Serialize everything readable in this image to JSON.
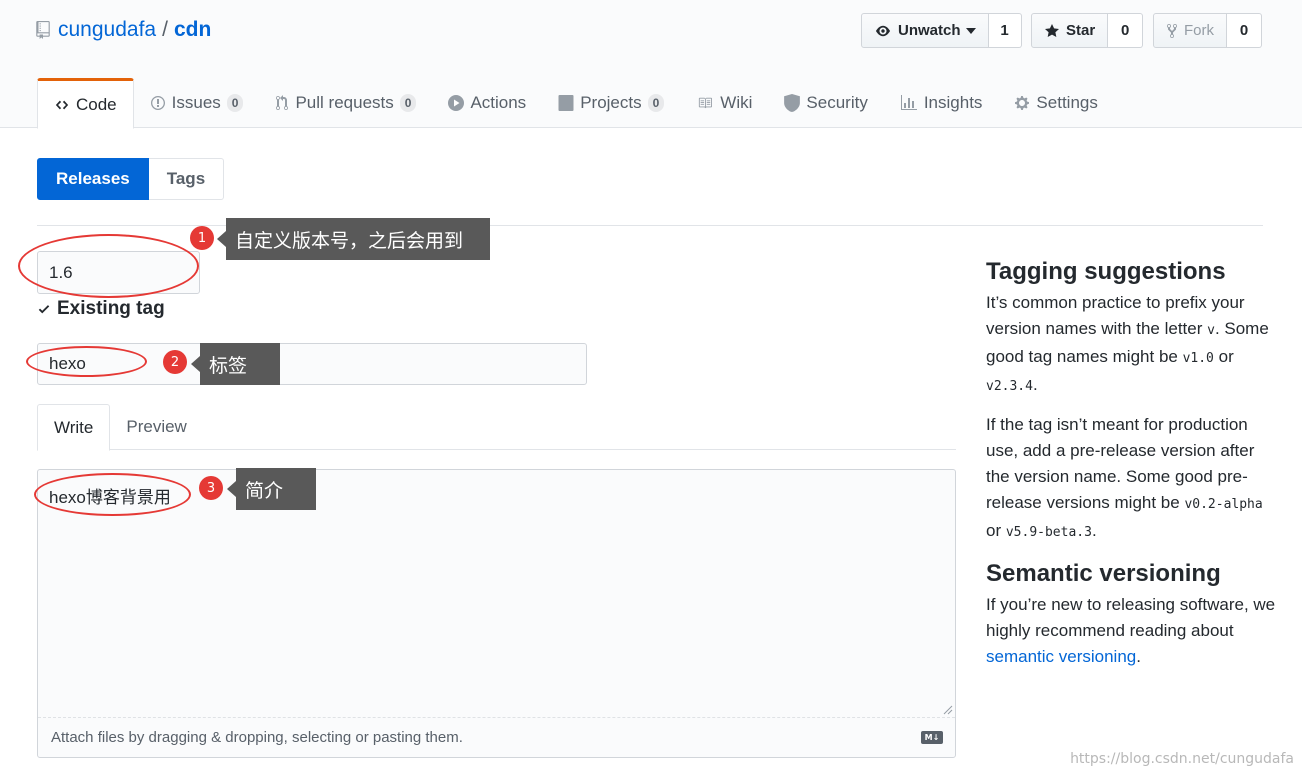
{
  "repo": {
    "owner": "cungudafa",
    "separator": "/",
    "name": "cdn"
  },
  "actions": {
    "watch": {
      "label": "Unwatch",
      "count": "1"
    },
    "star": {
      "label": "Star",
      "count": "0"
    },
    "fork": {
      "label": "Fork",
      "count": "0"
    }
  },
  "tabs": [
    {
      "label": "Code"
    },
    {
      "label": "Issues",
      "count": "0"
    },
    {
      "label": "Pull requests",
      "count": "0"
    },
    {
      "label": "Actions"
    },
    {
      "label": "Projects",
      "count": "0"
    },
    {
      "label": "Wiki"
    },
    {
      "label": "Security"
    },
    {
      "label": "Insights"
    },
    {
      "label": "Settings"
    }
  ],
  "subnav": {
    "releases": "Releases",
    "tags": "Tags"
  },
  "form": {
    "tag_value": "1.6",
    "existing_tag": "Existing tag",
    "title_value": "hexo",
    "write_tab": "Write",
    "preview_tab": "Preview",
    "body_value": "hexo博客背景用",
    "attach_hint": "Attach files by dragging & dropping, selecting or pasting them.",
    "markdown_badge": "M↓"
  },
  "sidebar": {
    "tagging_title": "Tagging suggestions",
    "p1_a": "It’s common practice to prefix your version names with the letter ",
    "p1_code1": "v",
    "p1_b": ". Some good tag names might be ",
    "p1_code2": "v1.0",
    "p1_c": " or ",
    "p1_code3": "v2.3.4",
    "p1_d": ".",
    "p2_a": "If the tag isn’t meant for production use, add a pre-release version after the version name. Some good pre-release versions might be ",
    "p2_code1": "v0.2-alpha",
    "p2_b": " or ",
    "p2_code2": "v5.9-beta.3",
    "p2_c": ".",
    "semver_title": "Semantic versioning",
    "p3_a": "If you’re new to releasing software, we highly recommend reading about ",
    "p3_link": "semantic versioning",
    "p3_b": "."
  },
  "annotations": [
    {
      "number": "1",
      "text": "自定义版本号，之后会用到"
    },
    {
      "number": "2",
      "text": "标签"
    },
    {
      "number": "3",
      "text": "简介"
    }
  ],
  "watermark": "https://blog.csdn.net/cungudafa",
  "colors": {
    "accent": "#0366d6",
    "tab_highlight": "#e36209",
    "annotation_red": "#e53935",
    "callout_bg": "#595959"
  }
}
